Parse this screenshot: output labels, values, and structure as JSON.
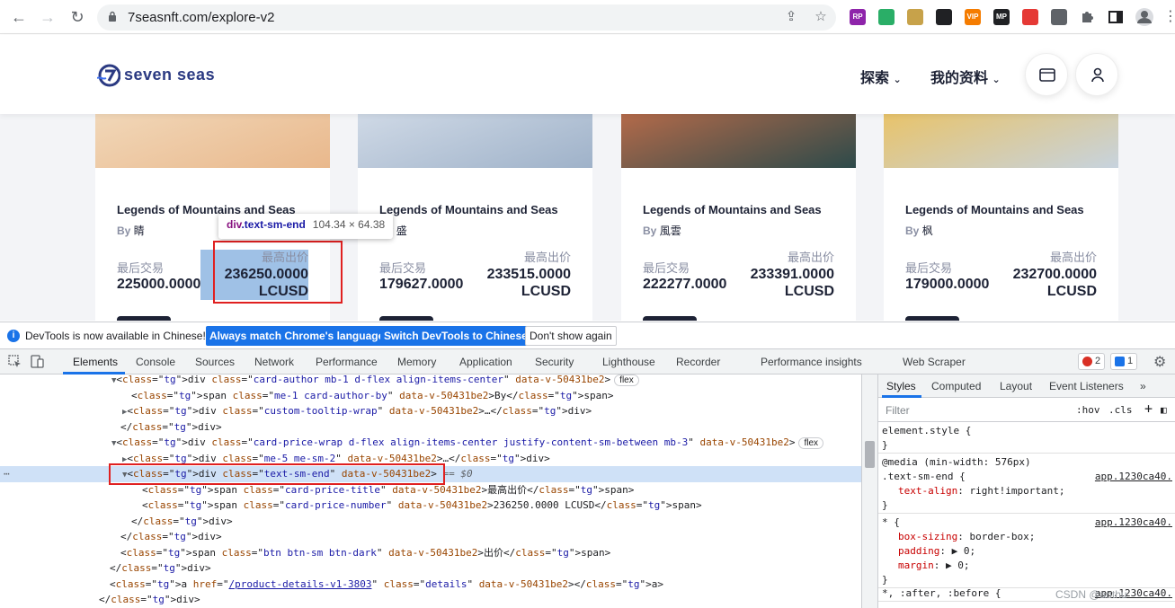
{
  "browser": {
    "url": "7seasnft.com/explore-v2",
    "extensions": [
      {
        "name": "rp-extension",
        "label": "RP",
        "color": "#8e24aa"
      },
      {
        "name": "wechat-extension",
        "label": "",
        "color": "#2aae67"
      },
      {
        "name": "image-extension",
        "label": "",
        "color": "#c7a24a"
      },
      {
        "name": "ghost-extension",
        "label": "",
        "color": "#202124"
      },
      {
        "name": "vip-extension",
        "label": "VIP",
        "color": "#f57c00"
      },
      {
        "name": "mp-extension",
        "label": "MP",
        "color": "#202124"
      },
      {
        "name": "arrow-extension",
        "label": "",
        "color": "#e53935"
      },
      {
        "name": "camera-extension",
        "label": "",
        "color": "#5f6368"
      }
    ]
  },
  "site": {
    "logo_text": "seven seas",
    "nav": {
      "explore": "探索",
      "profile": "我的资料"
    }
  },
  "cards": [
    {
      "title": "Legends of Mountains and Seas",
      "by": "By",
      "author": "睛",
      "last_title": "最后交易",
      "last_value": "225000.0000",
      "high_title": "最高出价",
      "high_value": "236250.0000",
      "high_unit": "LCUSD",
      "img_colors": [
        "#f1d7b8",
        "#e9b88c"
      ]
    },
    {
      "title": "Legends of Mountains and Seas",
      "by": "By",
      "author": "盛",
      "last_title": "最后交易",
      "last_value": "179627.0000",
      "high_title": "最高出价",
      "high_value": "233515.0000",
      "high_unit": "LCUSD",
      "img_colors": [
        "#cfd9e6",
        "#9fb2c9"
      ]
    },
    {
      "title": "Legends of Mountains and Seas",
      "by": "By",
      "author": "風雲",
      "last_title": "最后交易",
      "last_value": "222277.0000",
      "high_title": "最高出价",
      "high_value": "233391.0000",
      "high_unit": "LCUSD",
      "img_colors": [
        "#b36a4a",
        "#2d4a4a"
      ]
    },
    {
      "title": "Legends of Mountains and Seas",
      "by": "By",
      "author": "枫",
      "last_title": "最后交易",
      "last_value": "179000.0000",
      "high_title": "最高出价",
      "high_value": "232700.0000",
      "high_unit": "LCUSD",
      "img_colors": [
        "#e8c36a",
        "#c7d3de"
      ]
    }
  ],
  "tooltip": {
    "tag": "div",
    "cls": ".text-sm-end",
    "dims": "104.34 × 64.38"
  },
  "infobar": {
    "message": "DevTools is now available in Chinese!",
    "btn_match": "Always match Chrome's language",
    "btn_switch": "Switch DevTools to Chinese",
    "btn_dismiss": "Don't show again"
  },
  "devtools": {
    "tabs": [
      "Elements",
      "Console",
      "Sources",
      "Network",
      "Performance",
      "Memory",
      "Application",
      "Security",
      "Lighthouse",
      "Recorder",
      "Performance insights",
      "Web Scraper"
    ],
    "errors": "2",
    "messages": "1",
    "styles_tabs": [
      "Styles",
      "Computed",
      "Layout",
      "Event Listeners",
      "»"
    ],
    "filter_placeholder": "Filter",
    "hov": ":hov",
    "cls": ".cls"
  },
  "dom_lines": [
    {
      "indent": 124,
      "tri": "▼",
      "html": "div",
      "attrs": [
        [
          "class",
          "card-author mb-1 d-flex align-items-center"
        ],
        [
          "data-v-50431be2",
          ""
        ]
      ],
      "badge": "flex"
    },
    {
      "indent": 146,
      "tri": "",
      "text": "<span class=\"me-1 card-author-by\" data-v-50431be2>By</span>"
    },
    {
      "indent": 136,
      "tri": "▶",
      "text": "<div class=\"custom-tooltip-wrap\" data-v-50431be2>…</div>"
    },
    {
      "indent": 134,
      "tri": "",
      "text": "</div>"
    },
    {
      "indent": 124,
      "tri": "▼",
      "html": "div",
      "attrs": [
        [
          "class",
          "card-price-wrap d-flex align-items-center justify-content-sm-between mb-3"
        ],
        [
          "data-v-50431be2",
          ""
        ]
      ],
      "badge": "flex"
    },
    {
      "indent": 136,
      "tri": "▶",
      "text": "<div class=\"me-5 me-sm-2\" data-v-50431be2>…</div>"
    },
    {
      "indent": 136,
      "tri": "▼",
      "text": "<div class=\"text-sm-end\" data-v-50431be2>",
      "sel": true,
      "dollar": "== $0"
    },
    {
      "indent": 158,
      "tri": "",
      "text": "<span class=\"card-price-title\" data-v-50431be2>最高出价</span>"
    },
    {
      "indent": 158,
      "tri": "",
      "text": "<span class=\"card-price-number\" data-v-50431be2>236250.0000 LCUSD</span>"
    },
    {
      "indent": 146,
      "tri": "",
      "text": "</div>"
    },
    {
      "indent": 134,
      "tri": "",
      "text": "</div>"
    },
    {
      "indent": 134,
      "tri": "",
      "text": "<span class=\"btn btn-sm btn-dark\" data-v-50431be2>出价</span>"
    },
    {
      "indent": 122,
      "tri": "",
      "text": "</div>"
    },
    {
      "indent": 122,
      "tri": "",
      "text": "<a href=\"/product-details-v1-3803\" class=\"details\" data-v-50431be2></a>"
    },
    {
      "indent": 110,
      "tri": "",
      "text": "</div>"
    }
  ],
  "styles_rules": [
    {
      "lines": [
        "element.style {",
        "}"
      ],
      "src": ""
    },
    {
      "lines": [
        "@media (min-width: 576px)",
        ".text-sm-end {",
        "  text-align: right!important;",
        "}"
      ],
      "src": "app.1230ca40."
    },
    {
      "lines": [
        "* {",
        "  box-sizing: border-box;",
        "  padding: ▶ 0;",
        "  margin: ▶ 0;",
        "}"
      ],
      "src": "app.1230ca40."
    },
    {
      "lines": [
        "*, :after, :before {"
      ],
      "src": "app.1230ca40."
    }
  ],
  "watermark": "CSDN @anthu"
}
